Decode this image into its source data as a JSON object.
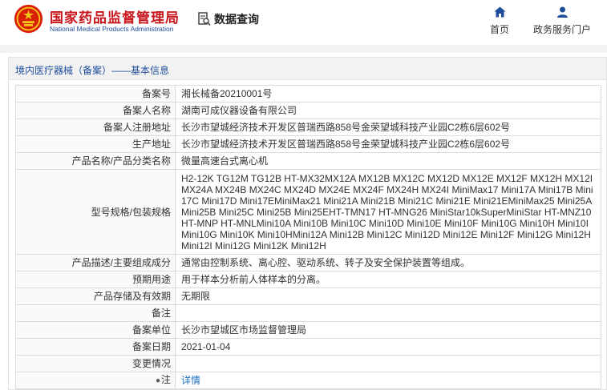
{
  "header": {
    "brand_cn": "国家药品监督管理局",
    "brand_en": "National Medical Products Administration",
    "data_search_label": "数据查询",
    "nav": [
      {
        "label": "首页",
        "icon": "home-icon"
      },
      {
        "label": "政务服务门户",
        "icon": "user-icon"
      }
    ],
    "colors": {
      "brand_red": "#c8161d",
      "brand_blue": "#1d4d9b"
    }
  },
  "panel": {
    "title": "境内医疗器械（备案）——基本信息"
  },
  "rows": [
    {
      "label": "备案号",
      "value": "湘长械备20210001号"
    },
    {
      "label": "备案人名称",
      "value": "湖南可成仪器设备有限公司"
    },
    {
      "label": "备案人注册地址",
      "value": "长沙市望城经济技术开发区普瑞西路858号金荣望城科技产业园C2栋6层602号"
    },
    {
      "label": "生产地址",
      "value": "长沙市望城经济技术开发区普瑞西路858号金荣望城科技产业园C2栋6层602号"
    },
    {
      "label": "产品名称/产品分类名称",
      "value": "微量高速台式离心机"
    },
    {
      "label": "型号规格/包装规格",
      "value": "H2-12K TG12M TG12B HT-MX32MX12A MX12B MX12C MX12D MX12E MX12F MX12H MX12IMX24A MX24B MX24C MX24D MX24E MX24F MX24H MX24I MiniMax17 Mini17A Mini17B Mini17C Mini17D Mini17EMiniMax21 Mini21A Mini21B Mini21C Mini21E Mini21EMiniMax25 Mini25A Mini25B Mini25C Mini25B Mini25EHT-TMN17 HT-MNG26 MiniStar10kSuperMiniStar HT-MNZ10 HT-MNP HT-MNLMini10A Mini10B Mini10C Mini10D Mini10E Mini10F Mini10G Mini10H Mini10I Mini10G Mini10K Mini10HMini12A Mini12B Mini12C Mini12D Mini12E Mini12F Mini12G Mini12H Mini12I Mini12G Mini12K Mini12H"
    },
    {
      "label": "产品描述/主要组成成分",
      "value": "通常由控制系统、离心腔、驱动系统、转子及安全保护装置等组成。"
    },
    {
      "label": "预期用途",
      "value": "用于样本分析前人体样本的分离。"
    },
    {
      "label": "产品存储及有效期",
      "value": "无期限"
    },
    {
      "label": "备注",
      "value": ""
    },
    {
      "label": "备案单位",
      "value": "长沙市望城区市场监督管理局"
    },
    {
      "label": "备案日期",
      "value": "2021-01-04"
    },
    {
      "label": "变更情况",
      "value": ""
    },
    {
      "label": "注",
      "value": "详情"
    }
  ]
}
